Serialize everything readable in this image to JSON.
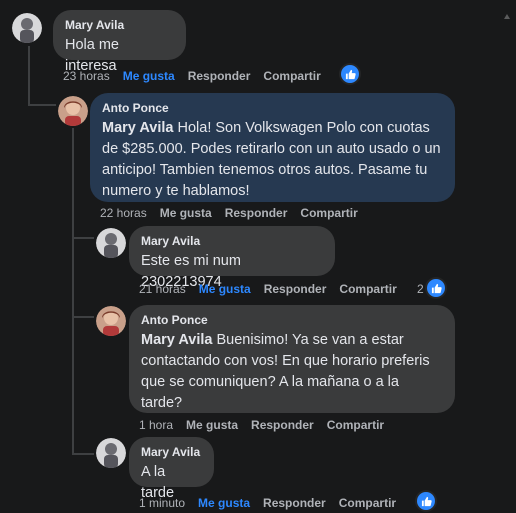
{
  "comments": [
    {
      "author": "Mary Avila",
      "mention": "",
      "text": "Hola me interesa",
      "time": "23 horas",
      "like": "Me gusta",
      "reply": "Responder",
      "share": "Compartir",
      "liked": true,
      "reactions": ""
    },
    {
      "author": "Anto Ponce",
      "mention": "Mary Avila",
      "text": " Hola! Son Volkswagen Polo con cuotas de $285.000. Podes retirarlo con un auto usado o un anticipo! Tambien tenemos otros autos. Pasame tu numero y te hablamos!",
      "time": "22 horas",
      "like": "Me gusta",
      "reply": "Responder",
      "share": "Compartir",
      "liked": false,
      "reactions": ""
    },
    {
      "author": "Mary Avila",
      "mention": "",
      "text": "Este es mi num 2302213974",
      "time": "21 horas",
      "like": "Me gusta",
      "reply": "Responder",
      "share": "Compartir",
      "liked": true,
      "reactions": "2"
    },
    {
      "author": "Anto Ponce",
      "mention": "Mary Avila",
      "text": " Buenisimo! Ya se van a estar contactando con vos! En que horario preferis que se comuniquen? A la mañana o a la tarde?",
      "time": "1 hora",
      "like": "Me gusta",
      "reply": "Responder",
      "share": "Compartir",
      "liked": false,
      "reactions": ""
    },
    {
      "author": "Mary Avila",
      "mention": "",
      "text": "A la tarde",
      "time": "1 minuto",
      "like": "Me gusta",
      "reply": "Responder",
      "share": "Compartir",
      "liked": true,
      "reactions": ""
    }
  ],
  "colors": {
    "accent": "#2d88ff",
    "highlight_bubble": "#263951",
    "bubble": "#3a3b3c",
    "background": "#18191a"
  }
}
